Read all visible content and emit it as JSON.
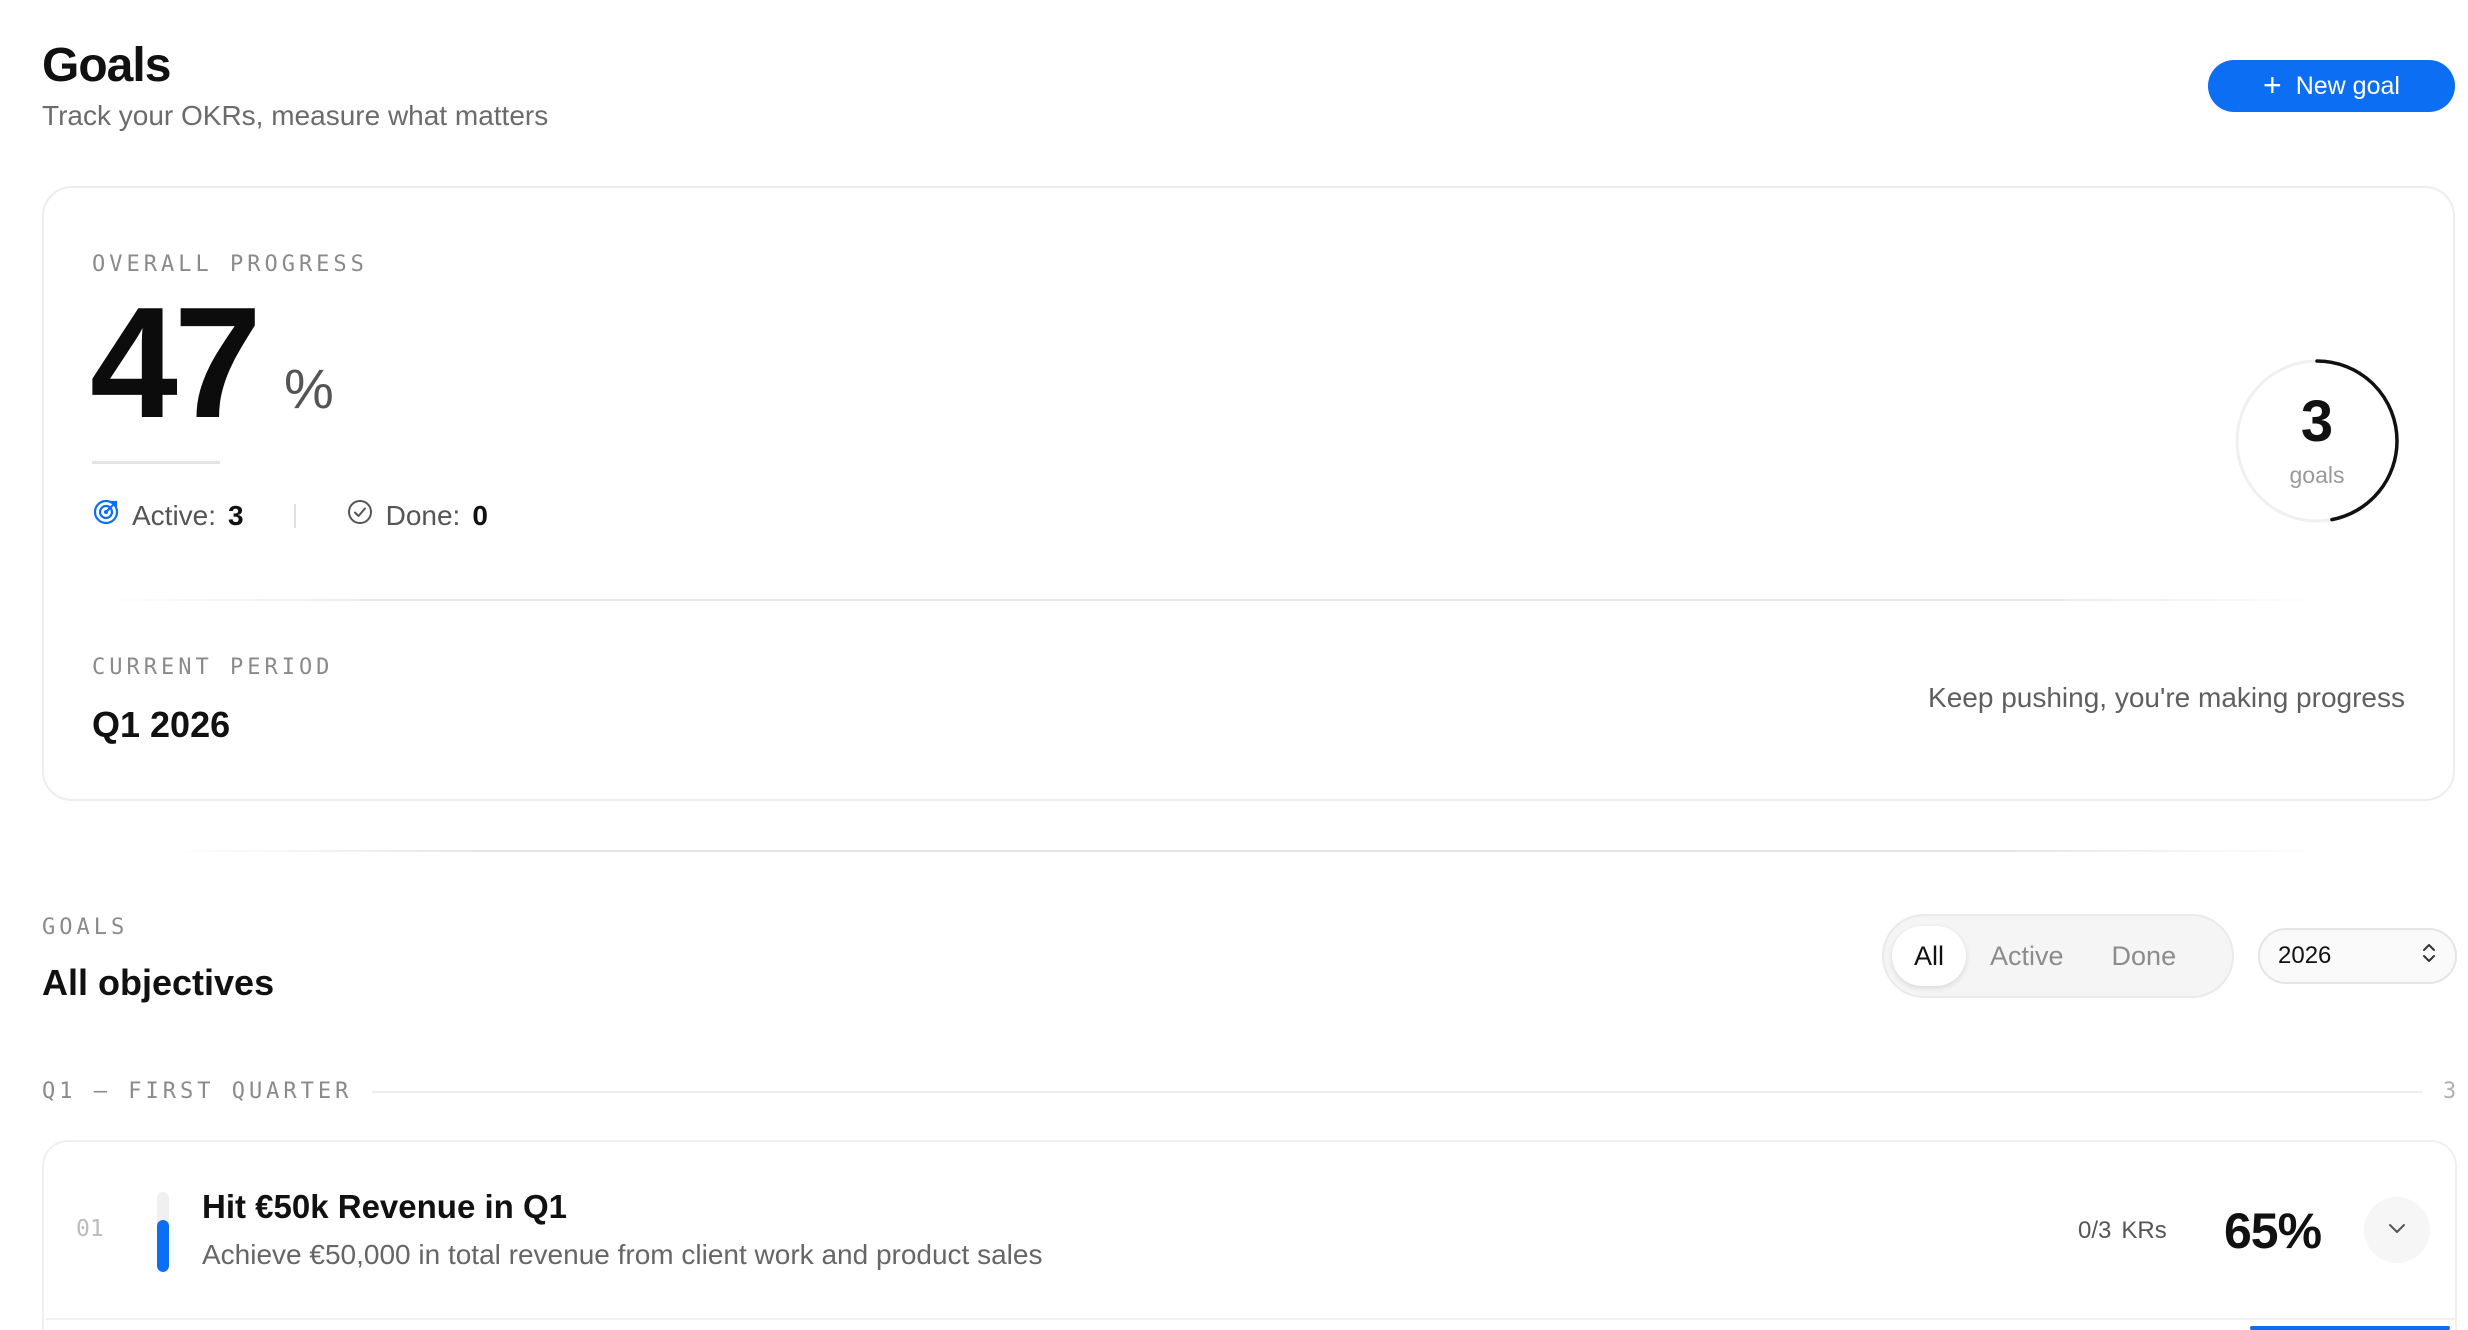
{
  "header": {
    "title": "Goals",
    "subtitle": "Track your OKRs, measure what matters",
    "new_goal_label": "New goal",
    "new_goal_icon": "plus-icon"
  },
  "overview": {
    "overall_label": "OVERALL PROGRESS",
    "overall_value": "47",
    "overall_unit": "%",
    "overall_fraction": 0.47,
    "active_label": "Active:",
    "active_count": "3",
    "done_label": "Done:",
    "done_count": "0",
    "ring_value": "3",
    "ring_label": "goals",
    "ring_fraction": 0.47,
    "period_label": "CURRENT PERIOD",
    "period_value": "Q1 2026",
    "message": "Keep pushing, you're making progress"
  },
  "goals_section": {
    "eyebrow": "GOALS",
    "heading": "All objectives",
    "filters": [
      "All",
      "Active",
      "Done"
    ],
    "selected_filter": "All",
    "year": "2026"
  },
  "quarter": {
    "label": "Q1 — FIRST QUARTER",
    "count": "3"
  },
  "goals": [
    {
      "index": "01",
      "title": "Hit €50k Revenue in Q1",
      "description": "Achieve €50,000 in total revenue from client work and product sales",
      "krs": "0/3",
      "krs_unit": "KRs",
      "percent": "65%",
      "progress": 0.65
    }
  ],
  "colors": {
    "accent": "#0b6ef3",
    "text": "#111111",
    "muted": "#6b6b6b"
  }
}
